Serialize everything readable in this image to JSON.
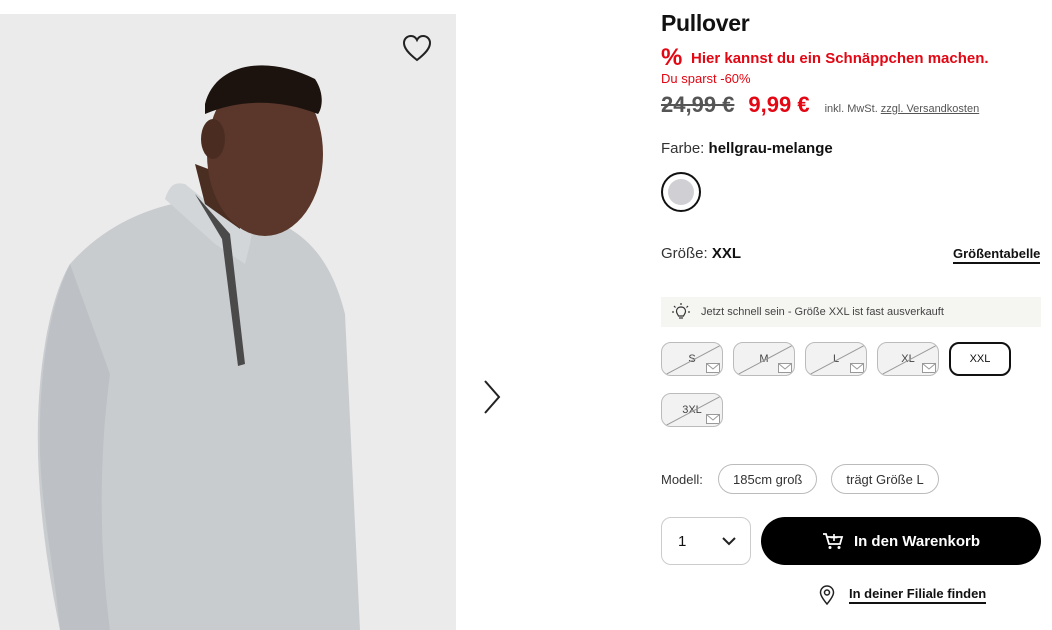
{
  "product": {
    "title": "Pullover",
    "deal_icon": "%",
    "deal_text": "Hier kannst du ein Schnäppchen machen.",
    "savings_text": "Du sparst -60%",
    "old_price": "24,99 €",
    "new_price": "9,99 €",
    "tax_text": "inkl. MwSt.",
    "shipping_link": "zzgl. Versandkosten",
    "accent_color": "#e30613"
  },
  "color": {
    "label": "Farbe:",
    "value": "hellgrau-melange",
    "swatch_color": "#cfcfd4"
  },
  "size": {
    "label": "Größe:",
    "value": "XXL",
    "chart_link": "Größentabelle",
    "hint": "Jetzt schnell sein - Größe XXL ist fast ausverkauft",
    "options": [
      {
        "label": "S",
        "available": false
      },
      {
        "label": "M",
        "available": false
      },
      {
        "label": "L",
        "available": false
      },
      {
        "label": "XL",
        "available": false
      },
      {
        "label": "XXL",
        "available": true,
        "selected": true
      },
      {
        "label": "3XL",
        "available": false
      }
    ]
  },
  "model": {
    "label": "Modell:",
    "height": "185cm groß",
    "wears": "trägt Größe L"
  },
  "cart": {
    "quantity": "1",
    "button_label": "In den Warenkorb"
  },
  "store": {
    "link": "In deiner Filiale finden"
  },
  "icons": {
    "wishlist": "heart-icon",
    "next": "chevron-right-icon",
    "hint": "lightbulb-icon",
    "cart": "cart-icon",
    "store": "location-pin-icon",
    "quantity": "chevron-down-icon",
    "notify": "mail-icon"
  }
}
